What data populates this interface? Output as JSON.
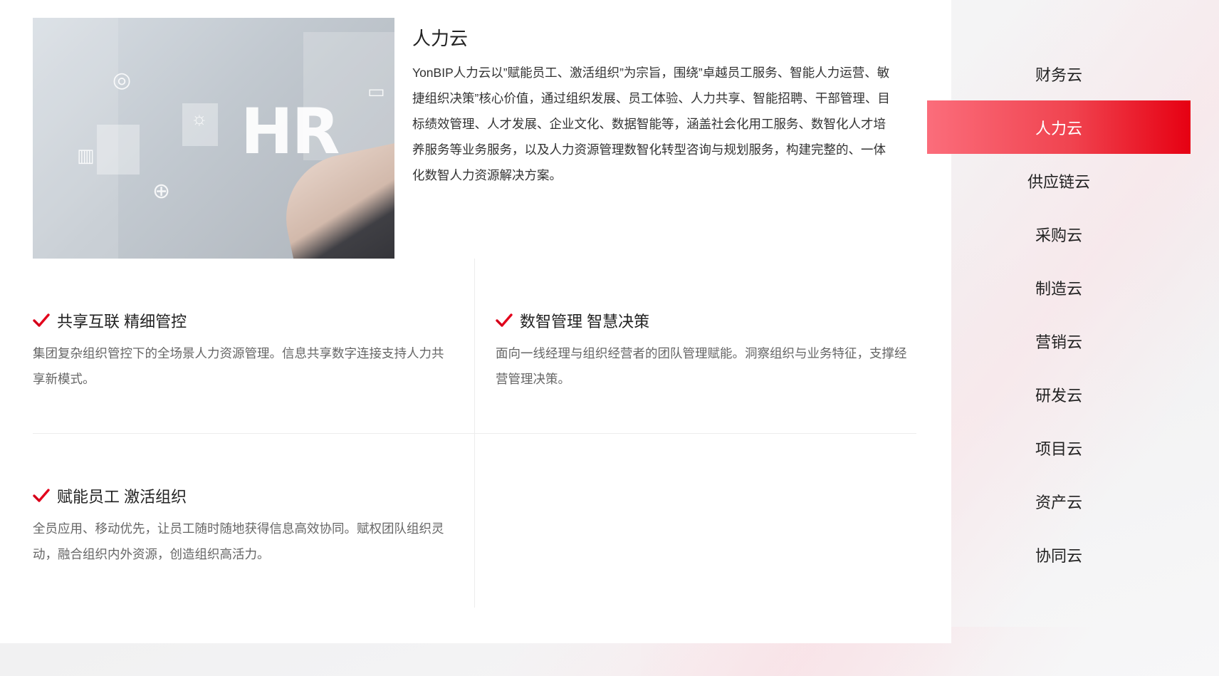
{
  "panel": {
    "title": "人力云",
    "description": "YonBIP人力云以”赋能员工、激活组织”为宗旨，围绕”卓越员工服务、智能人力运营、敏捷组织决策”核心价值，通过组织发展、员工体验、人力共享、智能招聘、干部管理、目标绩效管理、人才发展、企业文化、数据智能等，涵盖社会化用工服务、数智化人才培养服务等业务服务，以及人力资源管理数智化转型咨询与规划服务，构建完整的、一体化数智人力资源解决方案。",
    "image_text": "HR"
  },
  "features": [
    {
      "title": "共享互联 精细管控",
      "desc": "集团复杂组织管控下的全场景人力资源管理。信息共享数字连接支持人力共享新模式。"
    },
    {
      "title": "数智管理 智慧决策",
      "desc": "面向一线经理与组织经营者的团队管理赋能。洞察组织与业务特征，支撑经营管理决策。"
    },
    {
      "title": "赋能员工 激活组织",
      "desc": "全员应用、移动优先，让员工随时随地获得信息高效协同。赋权团队组织灵动，融合组织内外资源，创造组织高活力。"
    }
  ],
  "sidebar": {
    "items": [
      {
        "label": "财务云"
      },
      {
        "label": "人力云"
      },
      {
        "label": "供应链云"
      },
      {
        "label": "采购云"
      },
      {
        "label": "制造云"
      },
      {
        "label": "营销云"
      },
      {
        "label": "研发云"
      },
      {
        "label": "项目云"
      },
      {
        "label": "资产云"
      },
      {
        "label": "协同云"
      }
    ],
    "active_index": 1
  },
  "colors": {
    "accent": "#e60012",
    "accent_light": "#fb6d7b",
    "check": "#e3001b"
  }
}
